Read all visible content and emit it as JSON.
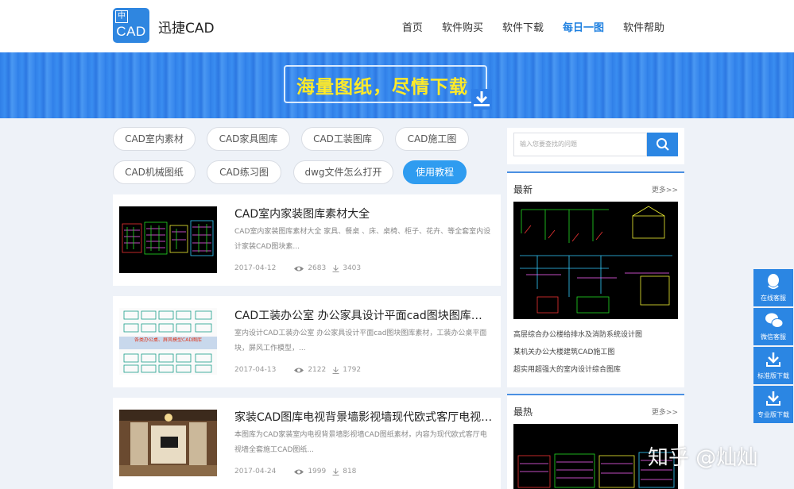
{
  "brand": {
    "logo_mark": "中",
    "logo_text": "CAD",
    "name": "迅捷CAD"
  },
  "nav": [
    "首页",
    "软件购买",
    "软件下载",
    "每日一图",
    "软件帮助"
  ],
  "banner": {
    "text": "海量图纸，尽情下载",
    "icon": "download-icon"
  },
  "tags": [
    "CAD室内素材",
    "CAD家具图库",
    "CAD工装图库",
    "CAD施工图",
    "CAD机械图纸",
    "CAD练习图",
    "dwg文件怎么打开",
    "使用教程"
  ],
  "articles": [
    {
      "title": "CAD室内家装图库素材大全",
      "desc": "CAD室内家装图库素材大全 家具、餐桌 、床、桌椅、柜子、花卉、等全套室内设计家装CAD图块素...",
      "date": "2017-04-12",
      "views": "2683",
      "downloads": "3403"
    },
    {
      "title": "CAD工装办公室 办公家具设计平面cad图块图库素材",
      "desc": "室内设计CAD工装办公室 办公家具设计平面cad图块图库素材，工装办公桌平面块，屏风工作模型，...",
      "date": "2017-04-13",
      "views": "2122",
      "downloads": "1792",
      "thumb_caption": "各类办公桌、屏风模型CAD图库"
    },
    {
      "title": "家装CAD图库电视背景墙影视墙现代欧式客厅电视墙...",
      "desc": "本图库为CAD家装室内电视背景墙影视墙CAD图纸素材，内容为现代欧式客厅电视墙全套施工CAD图纸...",
      "date": "2017-04-24",
      "views": "1999",
      "downloads": "818"
    }
  ],
  "search": {
    "placeholder": "输入您要查找的问题"
  },
  "latest": {
    "title": "最新",
    "more": "更多>>",
    "links": [
      "高层综合办公楼给排水及消防系统设计图",
      "某机关办公大楼建筑CAD施工图",
      "超实用超强大的室内设计综合图库"
    ]
  },
  "hottest": {
    "title": "最热",
    "more": "更多>>"
  },
  "service": [
    "在线客服",
    "微信客服",
    "标准版下载",
    "专业版下载"
  ],
  "watermark": "知乎 @灿灿",
  "colors": {
    "accent": "#2b86e3",
    "banner_text": "#ffea28",
    "active_tag": "#2f9cf0"
  }
}
